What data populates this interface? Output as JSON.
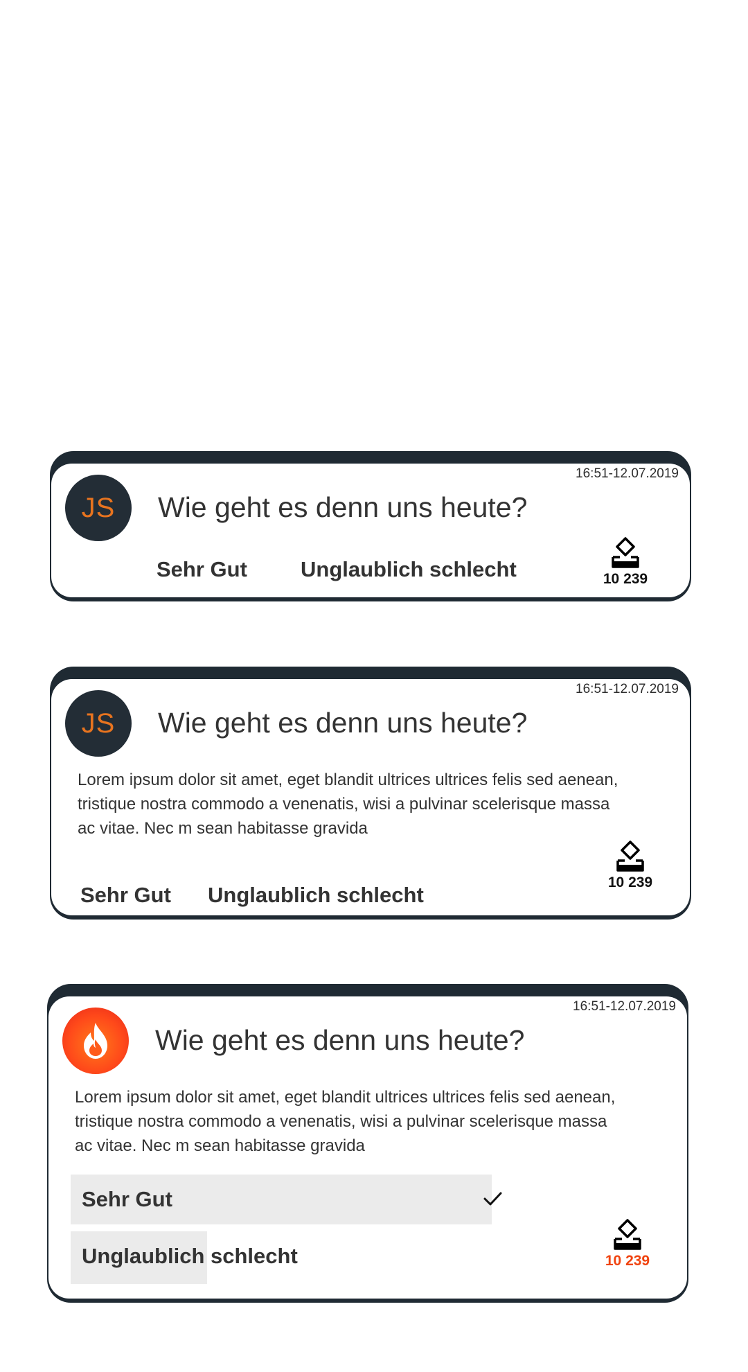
{
  "cards": [
    {
      "timestamp": "16:51-12.07.2019",
      "avatar_initials": "JS",
      "question": "Wie geht es denn uns heute?",
      "options": [
        "Sehr Gut",
        "Unglaublich schlecht"
      ],
      "vote_count": "10 239"
    },
    {
      "timestamp": "16:51-12.07.2019",
      "avatar_initials": "JS",
      "question": "Wie geht es denn uns heute?",
      "description": "Lorem ipsum dolor sit amet, eget blandit ultrices ultrices felis sed aenean, tristique nostra commodo a venenatis, wisi a pulvinar scelerisque massa ac vitae. Nec m sean habitasse gravida",
      "options": [
        "Sehr Gut",
        "Unglaublich schlecht"
      ],
      "vote_count": "10 239"
    },
    {
      "timestamp": "16:51-12.07.2019",
      "avatar_icon": "flame-icon",
      "question": "Wie geht es denn uns heute?",
      "description": "Lorem ipsum dolor sit amet, eget blandit ultrices ultrices felis sed aenean, tristique nostra commodo a venenatis, wisi a pulvinar scelerisque massa ac vitae. Nec m sean habitasse gravida",
      "results": [
        {
          "label": "Sehr Gut",
          "share": 0.8,
          "selected": true
        },
        {
          "label": "Unglaublich schlecht",
          "share": 0.2,
          "selected": false
        }
      ],
      "vote_count": "10 239"
    }
  ],
  "colors": {
    "card_frame": "#1f2a33",
    "avatar_bg": "#232d36",
    "avatar_text": "#e8741f",
    "accent_red": "#f0430f",
    "result_bar": "#ebebeb"
  }
}
